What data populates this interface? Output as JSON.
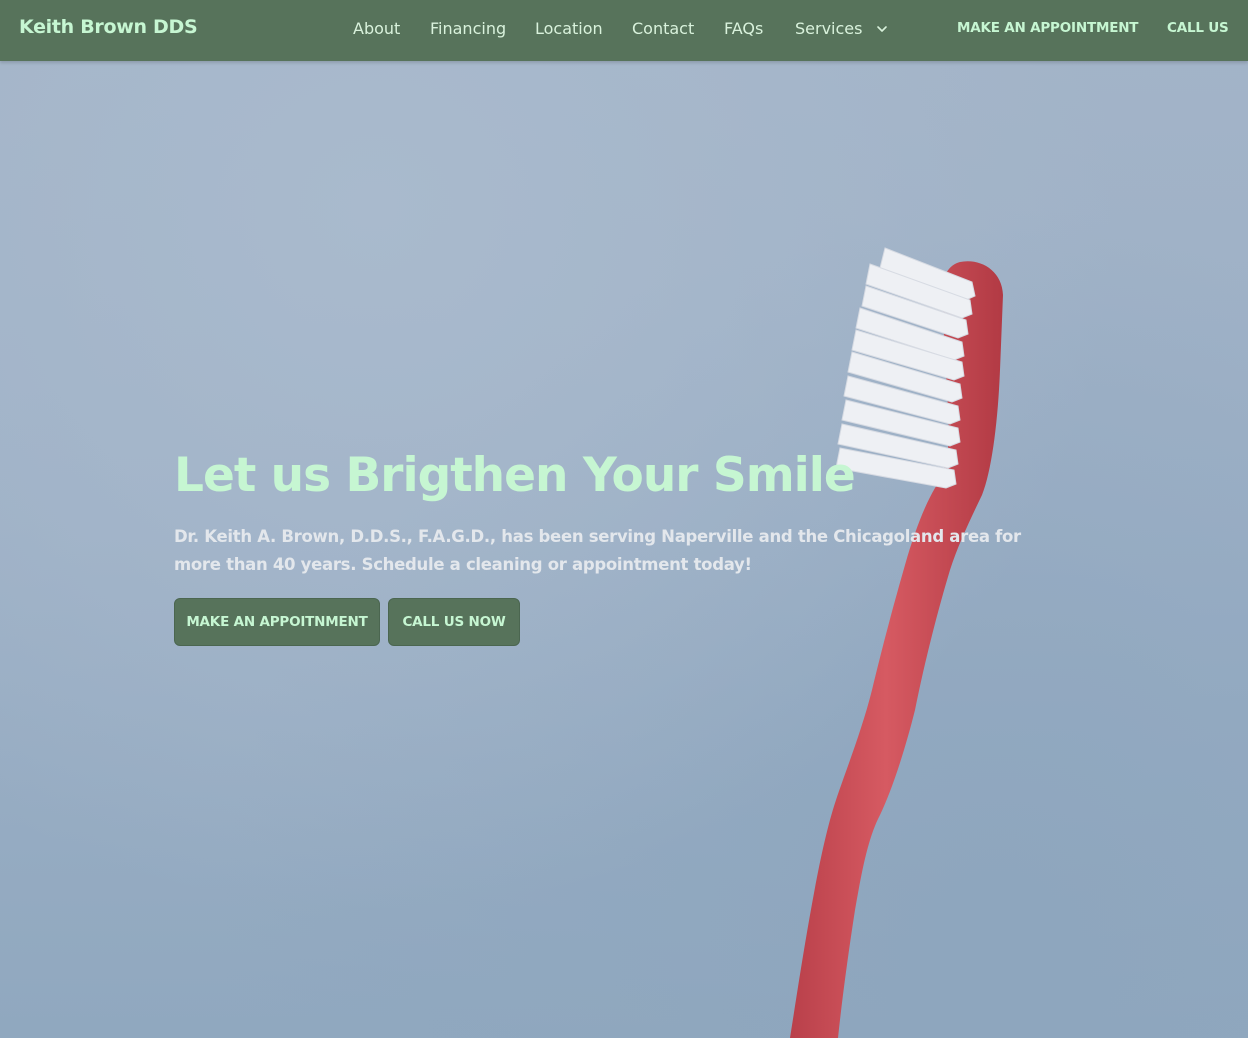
{
  "brand": {
    "name": "Keith Brown DDS"
  },
  "nav": {
    "links": [
      "About",
      "Financing",
      "Location",
      "Contact",
      "FAQs",
      "Services"
    ],
    "cta_appointment": "MAKE AN APPOINTMENT",
    "cta_call": "CALL US"
  },
  "hero": {
    "headline": "Let us Brigthen Your Smile",
    "subtext": "Dr. Keith A. Brown, D.D.S., F.A.G.D., has been serving Naperville and the Chicagoland area for more than 40 years. Schedule a cleaning or appointment today!",
    "primary_button": "MAKE AN APPOITNMENT",
    "secondary_button": "CALL US NOW"
  },
  "colors": {
    "nav_bg": "#57735b",
    "accent_text": "#c6f6d2",
    "hero_bg": "#9fb1c6",
    "toothbrush": "#c94a52"
  },
  "icons": {
    "services_dropdown": "chevron-down-icon"
  }
}
